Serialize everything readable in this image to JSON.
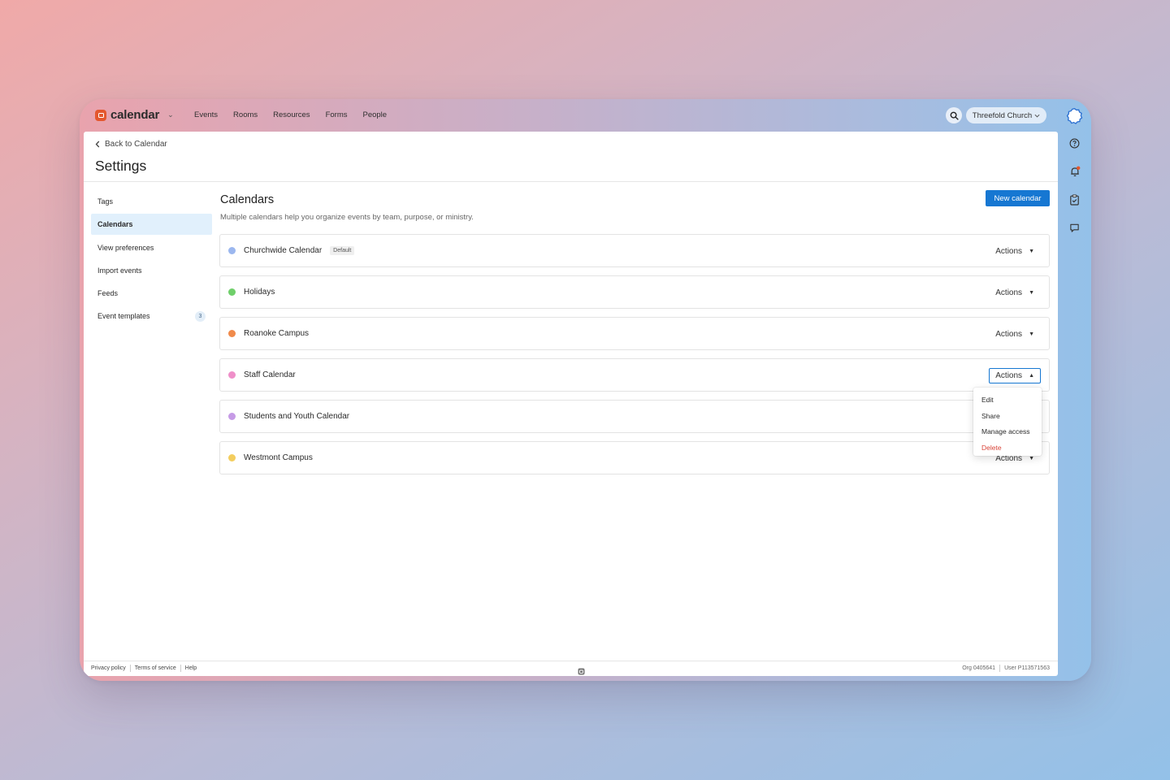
{
  "app": {
    "name": "calendar"
  },
  "nav": {
    "items": [
      "Events",
      "Rooms",
      "Resources",
      "Forms",
      "People"
    ]
  },
  "org_switcher": {
    "label": "Threefold Church"
  },
  "colors": {
    "brand": "#e4572e",
    "accent": "#1677d2",
    "danger": "#d9453a"
  },
  "header": {
    "back_label": "Back to Calendar",
    "title": "Settings"
  },
  "sidebar": {
    "items": [
      {
        "label": "Tags"
      },
      {
        "label": "Calendars",
        "active": true
      },
      {
        "label": "View preferences"
      },
      {
        "label": "Import events"
      },
      {
        "label": "Feeds"
      },
      {
        "label": "Event templates",
        "count": "3"
      }
    ]
  },
  "main": {
    "title": "Calendars",
    "subtitle": "Multiple calendars help you organize events by team, purpose, or ministry.",
    "new_button": "New calendar",
    "actions_label": "Actions",
    "default_badge": "Default",
    "calendars": [
      {
        "name": "Churchwide Calendar",
        "color": "#9bb7ef",
        "default": true
      },
      {
        "name": "Holidays",
        "color": "#6fcf6a"
      },
      {
        "name": "Roanoke Campus",
        "color": "#f08a4b"
      },
      {
        "name": "Staff Calendar",
        "color": "#ef8fc9",
        "menu_open": true
      },
      {
        "name": "Students and Youth Calendar",
        "color": "#c69be6"
      },
      {
        "name": "Westmont Campus",
        "color": "#f3cd5e"
      }
    ],
    "menu_options": [
      "Edit",
      "Share",
      "Manage access",
      "Delete"
    ]
  },
  "footer": {
    "links": [
      "Privacy policy",
      "Terms of service",
      "Help"
    ],
    "org_id": "Org 0405641",
    "user_id": "User P113571563"
  }
}
